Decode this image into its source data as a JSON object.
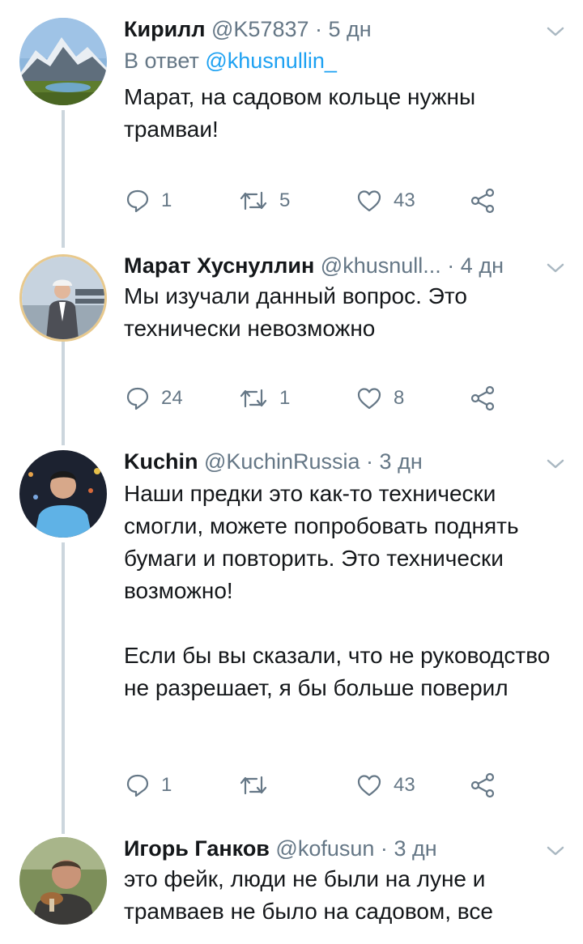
{
  "tweets": [
    {
      "name": "Кирилл",
      "handle": "@K57837",
      "time": "5 дн",
      "reply_prefix": "В ответ",
      "reply_to": "@khusnullin_",
      "text": "Марат, на садовом кольце нужны трамваи!",
      "replies": "1",
      "retweets": "5",
      "likes": "43"
    },
    {
      "name": "Марат Хуснуллин",
      "handle": "@khusnull...",
      "time": "4 дн",
      "text": "Мы изучали данный вопрос. Это технически невозможно",
      "replies": "24",
      "retweets": "1",
      "likes": "8"
    },
    {
      "name": "Kuchin",
      "handle": "@KuchinRussia",
      "time": "3 дн",
      "text": "Наши предки это как-то технически смогли, можете попробовать поднять бумаги и повторить. Это технически возможно!\n\nЕсли бы вы сказали, что не руководство не разрешает, я бы больше поверил",
      "replies": "1",
      "retweets": "",
      "likes": "43"
    },
    {
      "name": "Игорь Ганков",
      "handle": "@kofusun",
      "time": "3 дн",
      "text": "это фейк, люди не были на луне и трамваев не было на садовом, все"
    }
  ],
  "separator": "·",
  "colors": {
    "text": "#14171a",
    "secondary": "#657786",
    "link": "#1da1f2",
    "thread_line": "#ccd6dd"
  },
  "icons": [
    "reply-icon",
    "retweet-icon",
    "like-icon",
    "share-icon",
    "chevron-down-icon"
  ]
}
